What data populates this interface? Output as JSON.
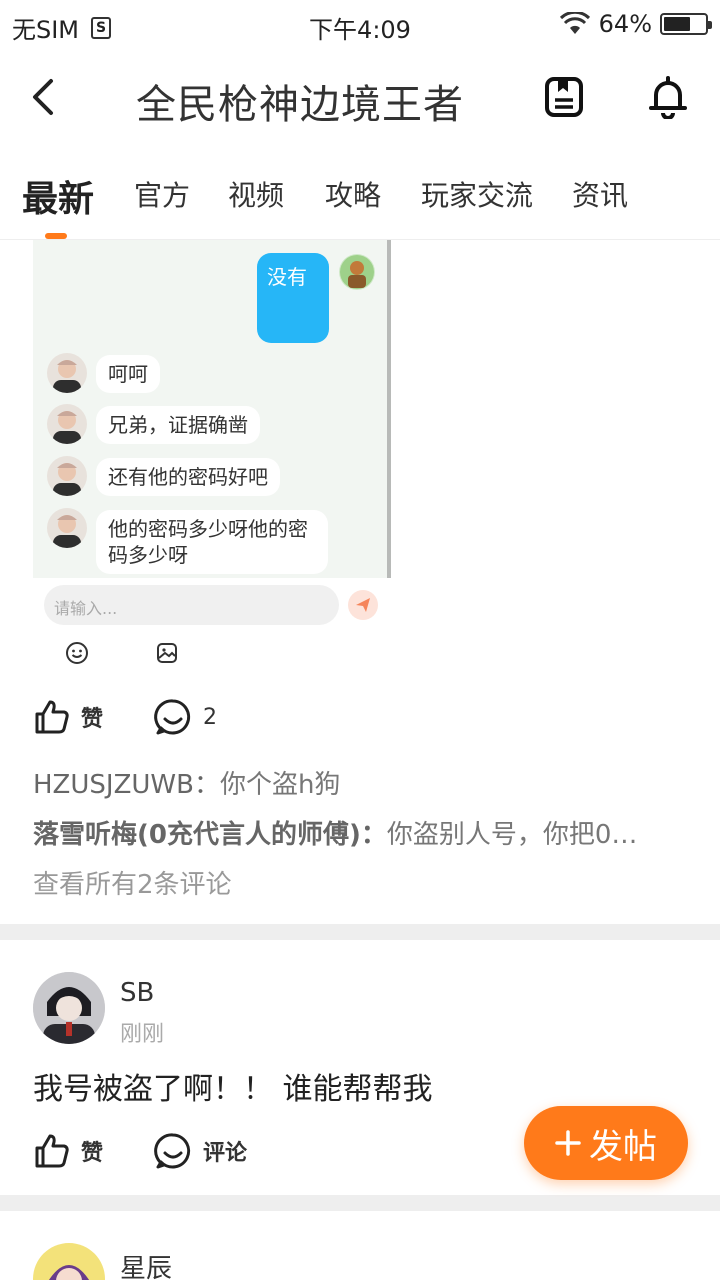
{
  "status_bar": {
    "carrier": "无SIM",
    "time": "下午4:09",
    "battery_percent": "64%",
    "battery_level": 0.64
  },
  "header": {
    "title": "全民枪神边境王者"
  },
  "tabs": [
    {
      "label": "最新",
      "active": true
    },
    {
      "label": "官方"
    },
    {
      "label": "视频"
    },
    {
      "label": "攻略"
    },
    {
      "label": "玩家交流"
    },
    {
      "label": "资讯"
    }
  ],
  "chat_screenshot": {
    "my_message": "没有",
    "messages": [
      "呵呵",
      "兄弟，证据确凿",
      "还有他的密码好吧",
      "他的密码多少呀他的密码多少呀"
    ],
    "input_placeholder": "请输入..."
  },
  "post1": {
    "like_label": "赞",
    "comment_count": "2",
    "comments": [
      {
        "user": "HZUSJZUWB：",
        "text": "你个盗h狗"
      },
      {
        "user": "落雪听梅(0充代言人的师傅)：",
        "text": "你盗别人号，你把0…"
      }
    ],
    "view_all": "查看所有2条评论"
  },
  "post2": {
    "username": "SB",
    "time": "刚刚",
    "content": "我号被盗了啊！！ 谁能帮帮我",
    "like_label": "赞",
    "comment_label": "评论"
  },
  "post3": {
    "username": "星辰"
  },
  "fab": {
    "label": "发帖"
  },
  "colors": {
    "accent": "#ff7a1a",
    "chat_blue": "#26b6f7"
  }
}
